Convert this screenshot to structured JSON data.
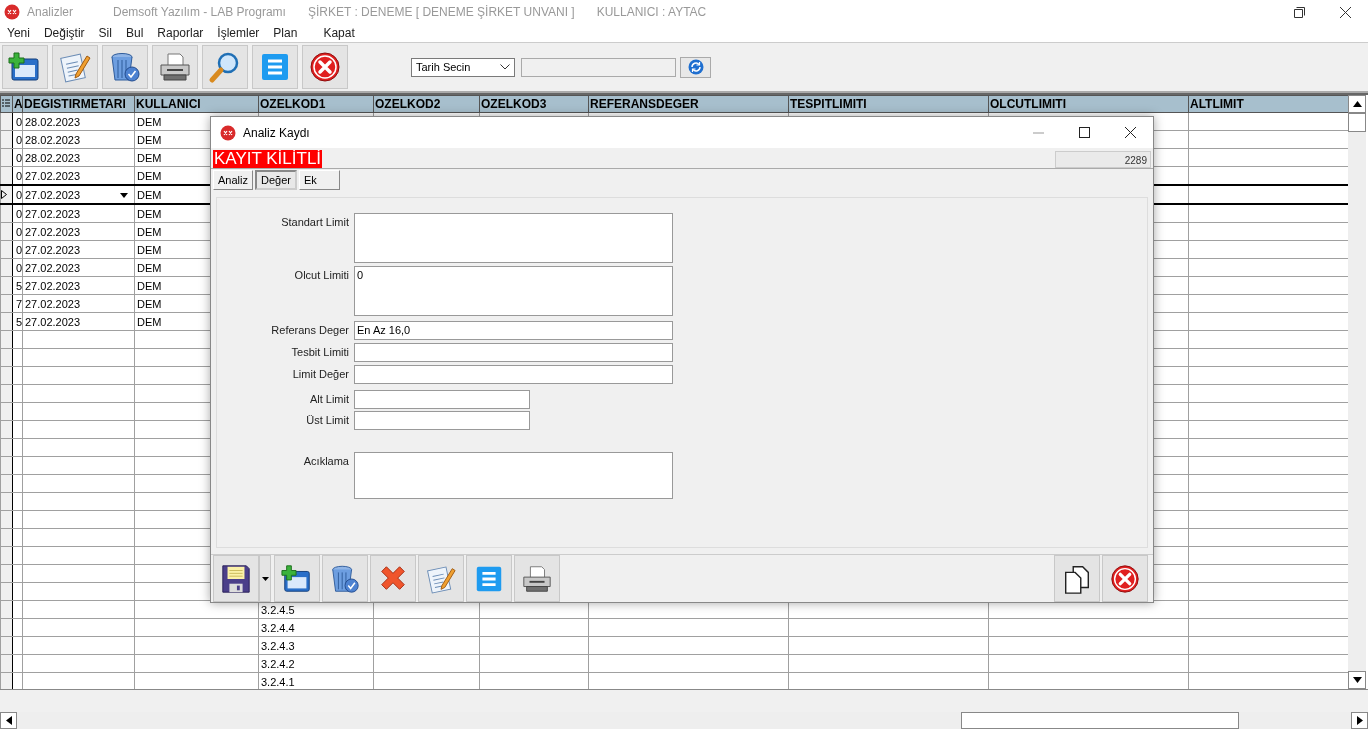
{
  "window": {
    "title": "Analizler",
    "subtitles": [
      "Demsoft Yazılım - LAB Programı",
      "ŞİRKET : DENEME [ DENEME ŞİRKET UNVANI ]",
      "KULLANICI : AYTAC"
    ]
  },
  "menu": [
    "Yeni",
    "Değiştir",
    "Sil",
    "Bul",
    "Raporlar",
    "İşlemler",
    "Plan",
    "Kapat"
  ],
  "toolbar": [
    {
      "kind": "new"
    },
    {
      "kind": "edit"
    },
    {
      "kind": "trash"
    },
    {
      "kind": "print"
    },
    {
      "kind": "search"
    },
    {
      "kind": "list"
    },
    {
      "kind": "close"
    }
  ],
  "date_filter": {
    "value": "Tarih Secin"
  },
  "grid": {
    "columns": [
      "A",
      "DEGISTIRMETARI",
      "KULLANICI",
      "OZELKOD1",
      "OZELKOD2",
      "OZELKOD3",
      "REFERANSDEGER",
      "TESPITLIMITI",
      "OLCUTLIMITI",
      "ALTLIMIT"
    ],
    "rows": [
      {
        "a": "0",
        "date": "28.02.2023",
        "user": "DEM",
        "selected": false
      },
      {
        "a": "0",
        "date": "28.02.2023",
        "user": "DEM",
        "selected": false
      },
      {
        "a": "0",
        "date": "28.02.2023",
        "user": "DEM",
        "selected": false
      },
      {
        "a": "0",
        "date": "27.02.2023",
        "user": "DEM",
        "selected": false
      },
      {
        "a": "0",
        "date": "27.02.2023",
        "user": "DEM",
        "selected": true
      },
      {
        "a": "0",
        "date": "27.02.2023",
        "user": "DEM",
        "selected": false
      },
      {
        "a": "0",
        "date": "27.02.2023",
        "user": "DEM",
        "selected": false
      },
      {
        "a": "0",
        "date": "27.02.2023",
        "user": "DEM",
        "selected": false
      },
      {
        "a": "0",
        "date": "27.02.2023",
        "user": "DEM",
        "selected": false
      },
      {
        "a": "5",
        "date": "27.02.2023",
        "user": "DEM",
        "selected": false
      },
      {
        "a": "7",
        "date": "27.02.2023",
        "user": "DEM",
        "selected": false
      },
      {
        "a": "5",
        "date": "27.02.2023",
        "user": "DEM",
        "selected": false
      },
      {
        "selected": false
      },
      {
        "selected": false
      },
      {
        "selected": false
      },
      {
        "selected": false
      },
      {
        "selected": false
      },
      {
        "selected": false
      },
      {
        "selected": false
      },
      {
        "selected": false
      },
      {
        "selected": false
      },
      {
        "selected": false
      },
      {
        "selected": false
      },
      {
        "selected": false
      },
      {
        "selected": false
      },
      {
        "selected": false
      },
      {
        "selected": false
      },
      {
        "code": "3.2.4.5",
        "selected": false
      },
      {
        "code": "3.2.4.4",
        "selected": false
      },
      {
        "code": "3.2.4.3",
        "selected": false
      },
      {
        "code": "3.2.4.2",
        "selected": false
      },
      {
        "code": "3.2.4.1",
        "selected": false
      }
    ]
  },
  "dialog": {
    "title": "Analiz Kaydı",
    "lock_banner": "KAYIT KİLİTLİ",
    "record_no": "2289",
    "tabs": [
      {
        "label": "Analiz",
        "selected": false
      },
      {
        "label": "Değer",
        "selected": true
      },
      {
        "label": "Ek",
        "selected": false
      }
    ],
    "fields": [
      {
        "label": "Standart Limit",
        "kind": "memo"
      },
      {
        "label": "Olcut Limiti",
        "value": "0",
        "kind": "memo"
      },
      {
        "label": "Referans Deger",
        "value": "En Az 16,0",
        "kind": "line"
      },
      {
        "label": "Tesbit Limiti",
        "kind": "line"
      },
      {
        "label": "Limit Değer",
        "kind": "line"
      },
      {
        "label": "Alt Limit",
        "kind": "short"
      },
      {
        "label": "Üst Limit",
        "kind": "short"
      },
      {
        "label": "Acıklama",
        "kind": "note"
      }
    ],
    "buttons": [
      {
        "kind": "save"
      },
      {
        "kind": "new"
      },
      {
        "kind": "trash"
      },
      {
        "kind": "delete"
      },
      {
        "kind": "edit"
      },
      {
        "kind": "list"
      },
      {
        "kind": "print"
      }
    ],
    "right_buttons": [
      {
        "kind": "copy"
      },
      {
        "kind": "close"
      }
    ]
  }
}
